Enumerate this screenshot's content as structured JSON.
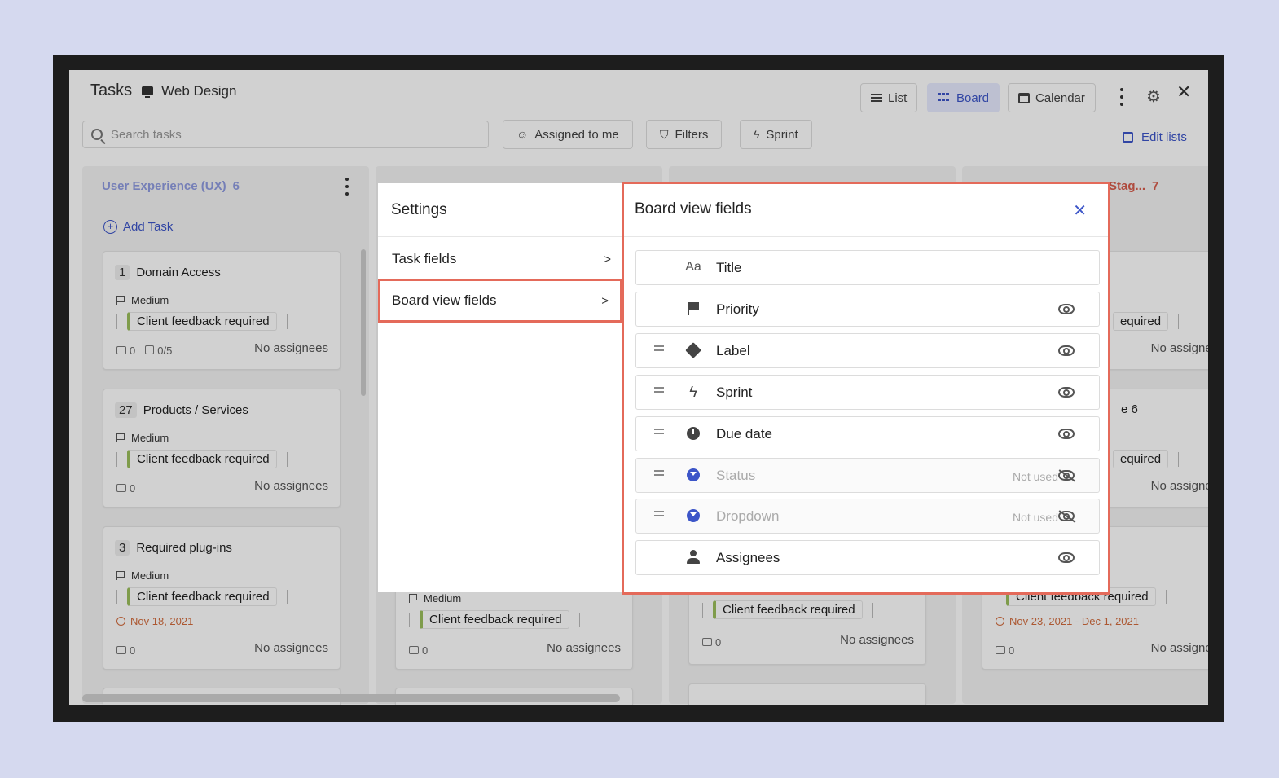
{
  "header": {
    "title": "Tasks",
    "project": "Web Design",
    "views": [
      "List",
      "Board",
      "Calendar"
    ],
    "active_view": "Board"
  },
  "toolbar": {
    "search_placeholder": "Search tasks",
    "assigned": "Assigned to me",
    "filters": "Filters",
    "sprint": "Sprint",
    "edit_lists": "Edit lists"
  },
  "columns": [
    {
      "title": "User Experience (UX)",
      "count": "6",
      "add_task": "Add Task",
      "cards": [
        {
          "num": "1",
          "title": "Domain Access",
          "priority": "Medium",
          "tag": "Client feedback required",
          "comments": "0",
          "checks": "0/5",
          "assignees": "No assignees"
        },
        {
          "num": "27",
          "title": "Products / Services",
          "priority": "Medium",
          "tag": "Client feedback required",
          "comments": "0",
          "assignees": "No assignees"
        },
        {
          "num": "3",
          "title": "Required plug-ins",
          "priority": "Medium",
          "tag": "Client feedback required",
          "date": "Nov 18, 2021",
          "comments": "0",
          "assignees": "No assignees"
        }
      ]
    },
    {
      "cards": [
        {
          "priority": "Medium",
          "tag": "Client feedback required",
          "comments": "0",
          "assignees": "No assignees"
        }
      ]
    },
    {
      "cards": [
        {
          "tag": "Client feedback required",
          "comments": "0",
          "assignees": "No assignees"
        }
      ]
    },
    {
      "title_partial": "Stag...",
      "count": "7",
      "cards": [
        {
          "tag_partial": "equired",
          "assignees_partial": "No assignee"
        },
        {
          "title_partial": "e 6",
          "tag_partial": "equired",
          "assignees_partial": "No assignee"
        },
        {
          "tag": "Client feedback required",
          "date": "Nov 23, 2021 - Dec 1, 2021",
          "comments": "0",
          "assignees_partial": "No assignee"
        }
      ]
    }
  ],
  "settings": {
    "title": "Settings",
    "items": [
      "Task fields",
      "Board view fields"
    ],
    "selected": "Board view fields"
  },
  "board_fields": {
    "title": "Board view fields",
    "not_used_label": "Not used",
    "fields": [
      {
        "name": "Title",
        "icon": "text-aa-icon",
        "draggable": false,
        "visible": true,
        "toggle": false
      },
      {
        "name": "Priority",
        "icon": "flag-icon",
        "draggable": false,
        "visible": true,
        "toggle": true
      },
      {
        "name": "Label",
        "icon": "tag-icon",
        "draggable": true,
        "visible": true,
        "toggle": true
      },
      {
        "name": "Sprint",
        "icon": "bolt-icon",
        "draggable": true,
        "visible": true,
        "toggle": true
      },
      {
        "name": "Due date",
        "icon": "clock-icon",
        "draggable": true,
        "visible": true,
        "toggle": true
      },
      {
        "name": "Status",
        "icon": "status-icon",
        "draggable": true,
        "visible": false,
        "toggle": true
      },
      {
        "name": "Dropdown",
        "icon": "dropdown-icon",
        "draggable": true,
        "visible": false,
        "toggle": true
      },
      {
        "name": "Assignees",
        "icon": "person-icon",
        "draggable": false,
        "visible": true,
        "toggle": true
      }
    ]
  },
  "colors": {
    "accent": "#3c55c8",
    "highlight": "#e46a5a",
    "tag_bar": "#9bbf5c",
    "date": "#d26b3c"
  }
}
